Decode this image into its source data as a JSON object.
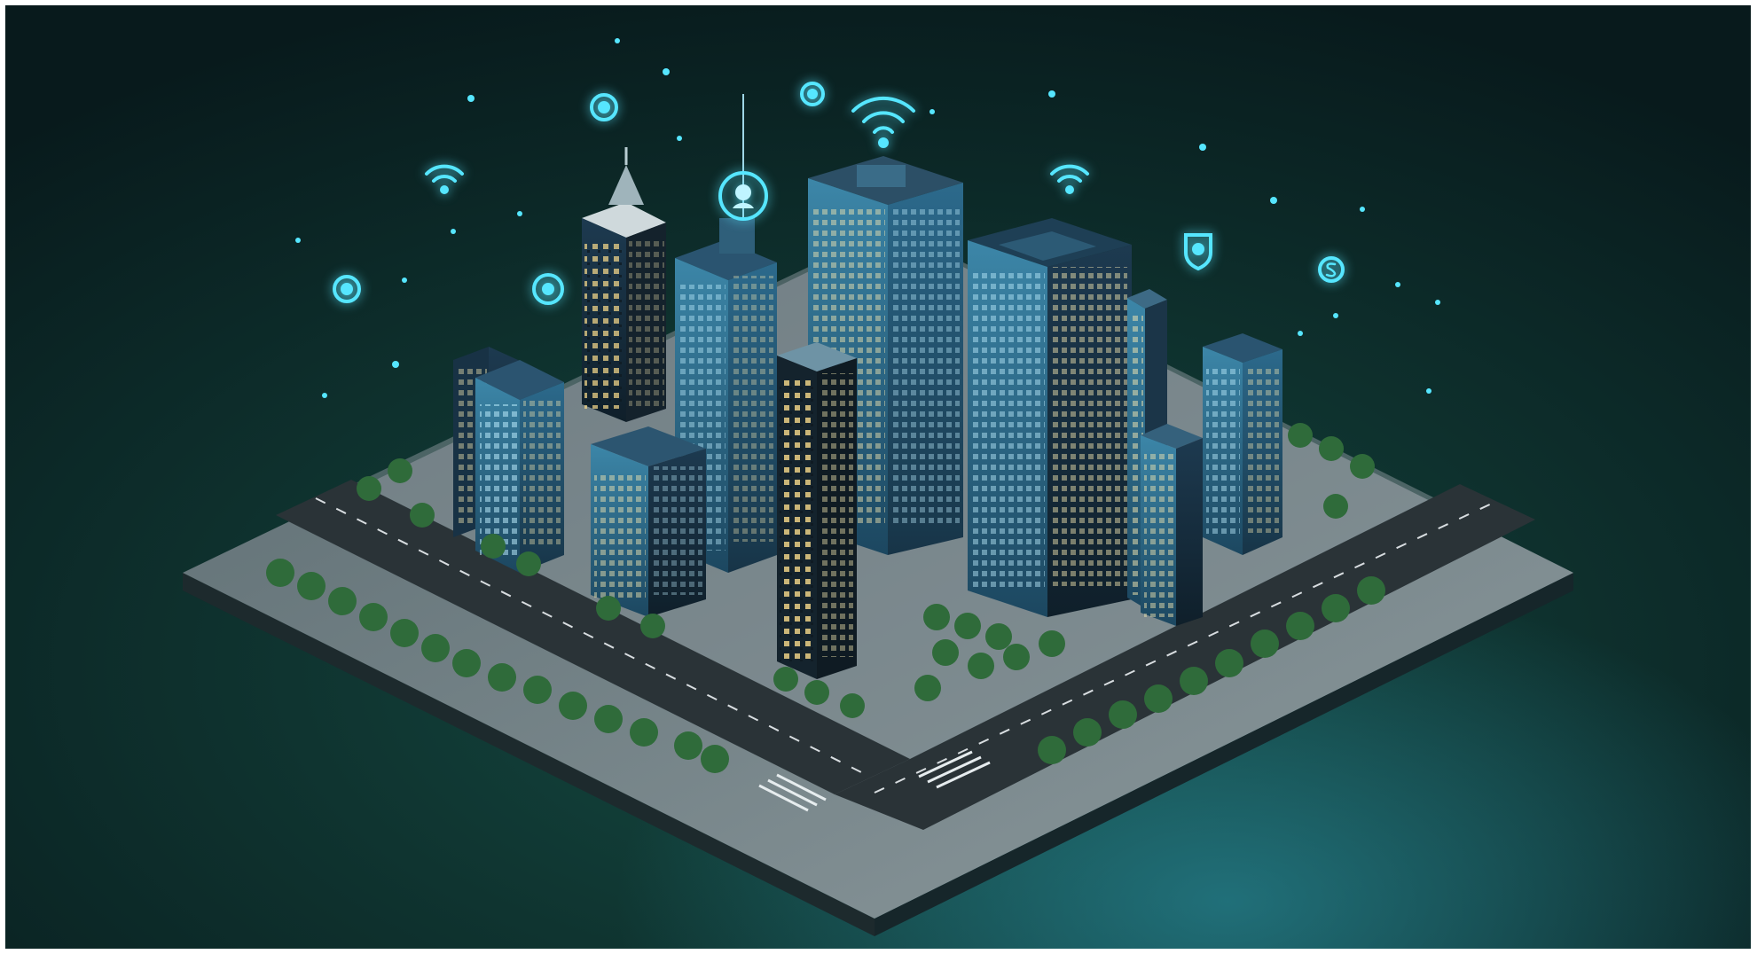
{
  "image": {
    "subject": "isometric-smart-city-block",
    "colors": {
      "background_top": "#0a1c1f",
      "background_mid": "#0e2c29",
      "background_bottom": "#0f3f37",
      "water_glow": "#1a6f7d",
      "platform_top": "#8a9aa0",
      "platform_side": "#1c2a2c",
      "road": "#2a3235",
      "building_glass": "#1f4d6b",
      "building_dark": "#15222c",
      "window_light": "#f4e6b0",
      "neon": "#56e6ff",
      "tree": "#2f6b3a"
    },
    "floating_icons": [
      {
        "name": "wifi-icon"
      },
      {
        "name": "wifi-icon"
      },
      {
        "name": "wifi-icon"
      },
      {
        "name": "location-pin-icon"
      },
      {
        "name": "location-pin-icon"
      },
      {
        "name": "location-pin-icon"
      },
      {
        "name": "shield-icon"
      },
      {
        "name": "dollar-icon"
      },
      {
        "name": "user-icon"
      },
      {
        "name": "cloud-icon"
      }
    ]
  }
}
